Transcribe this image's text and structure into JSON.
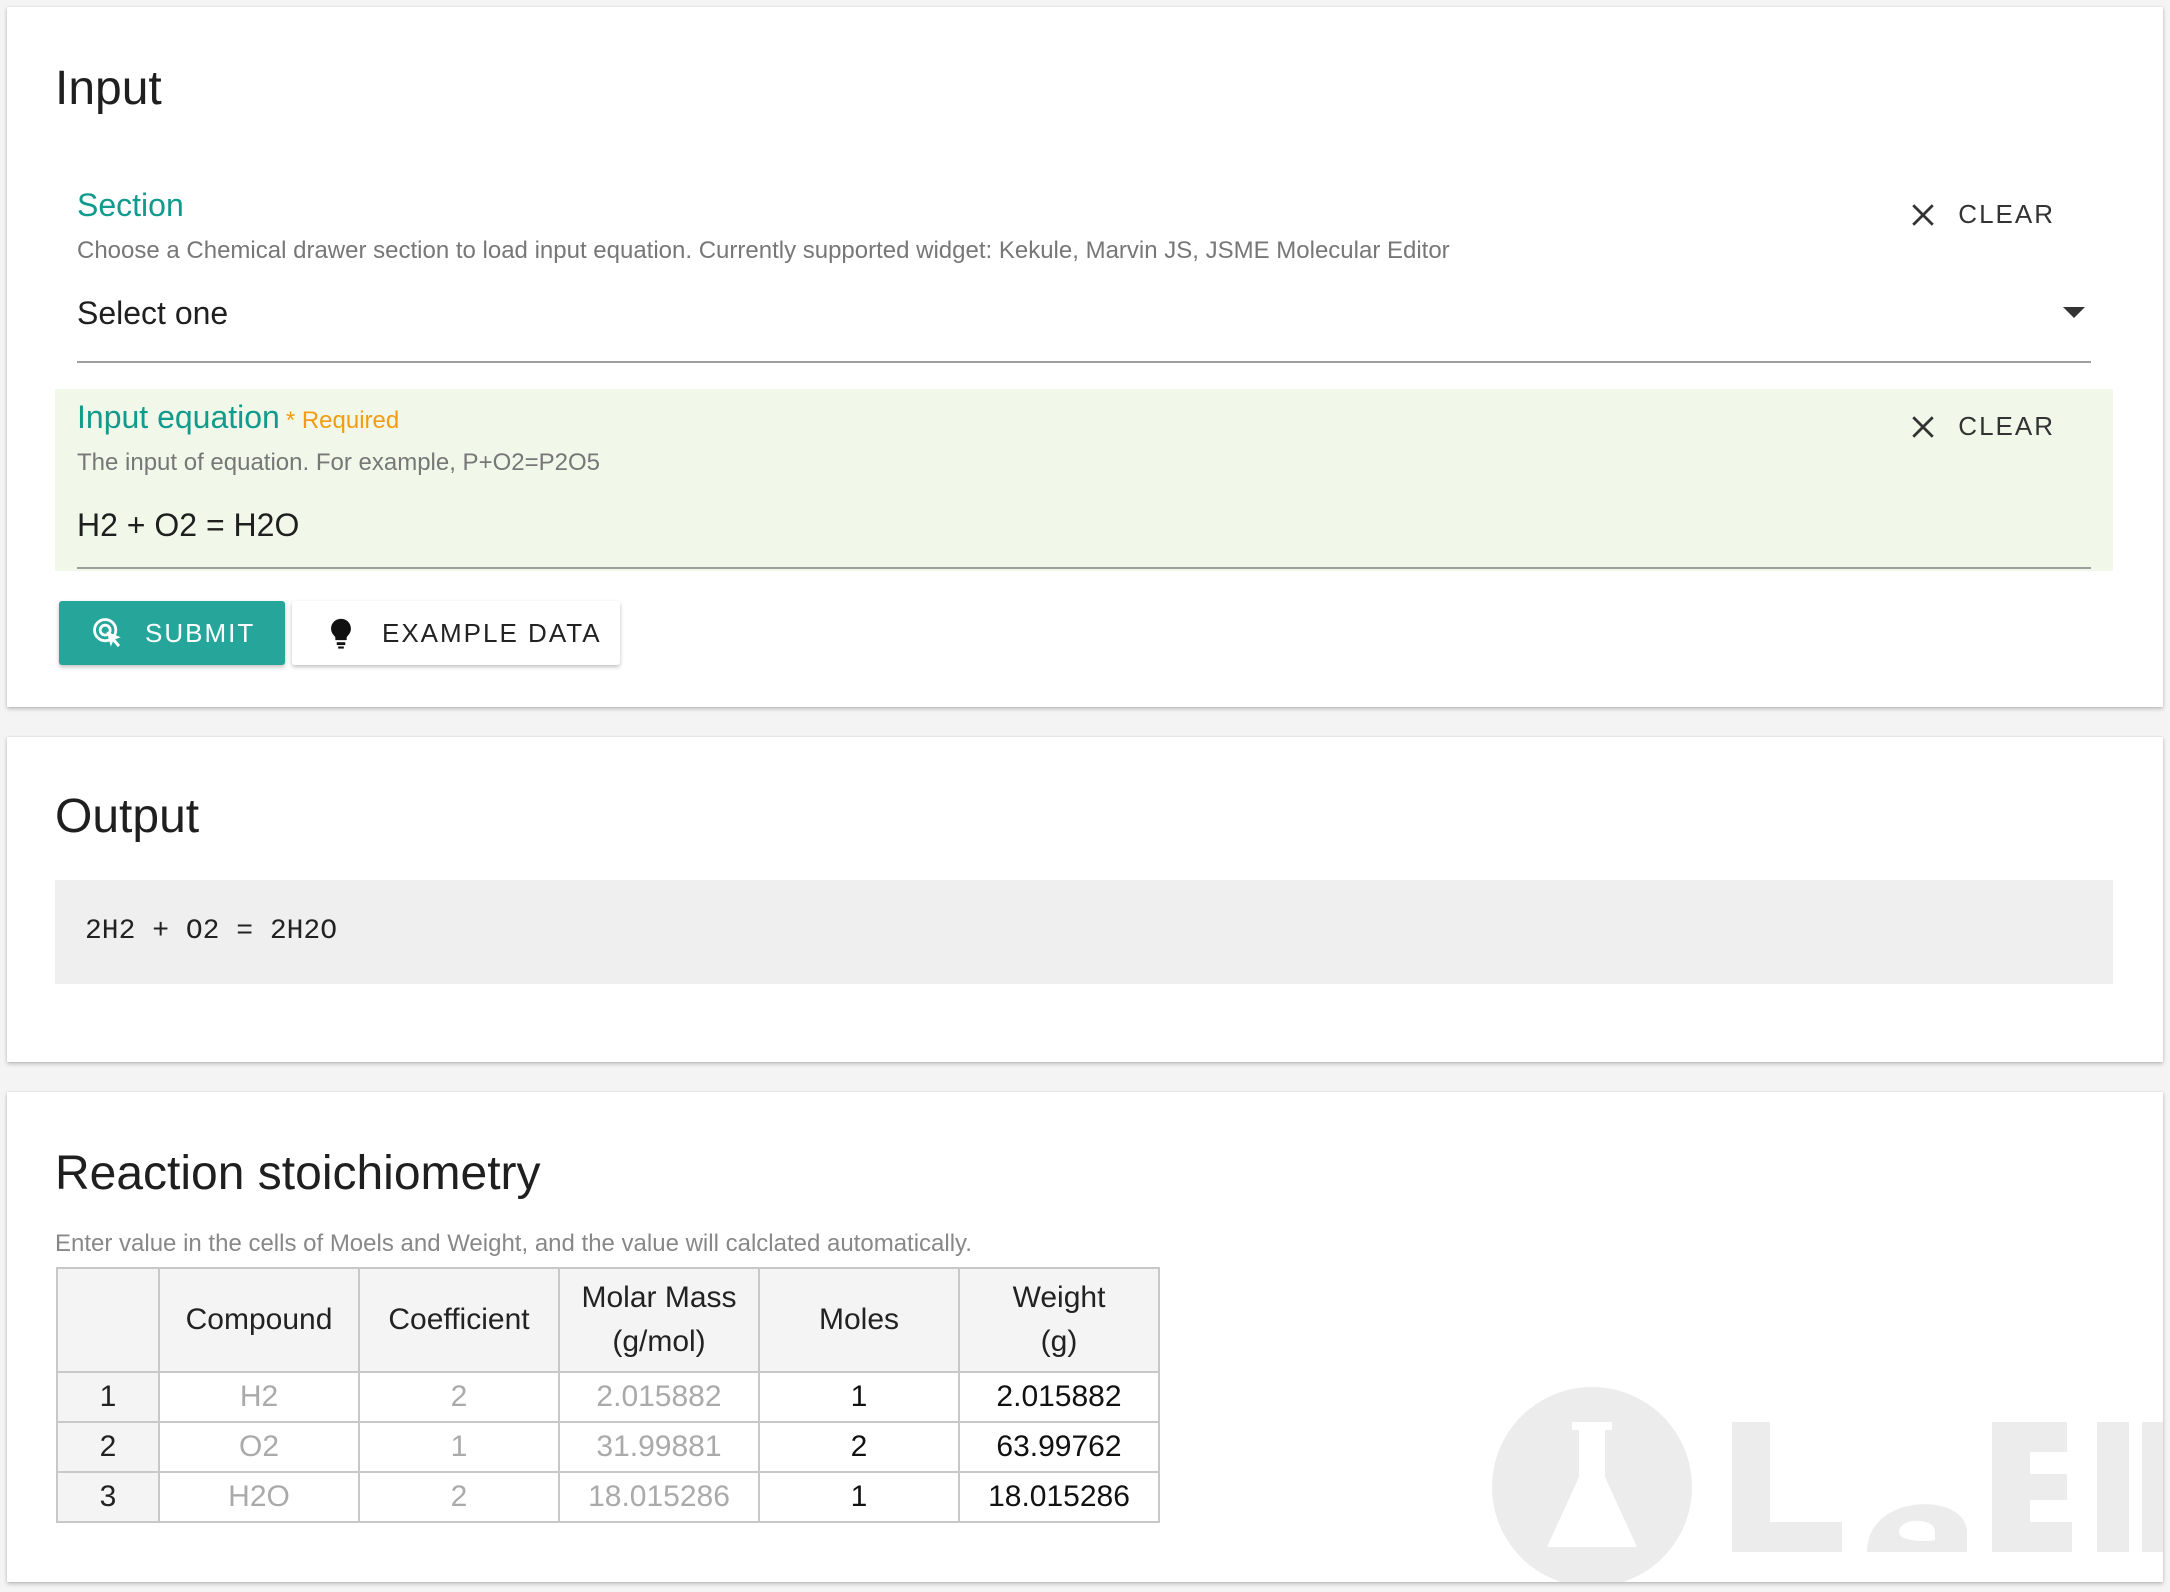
{
  "input_card": {
    "title": "Input",
    "section_field": {
      "label": "Section",
      "hint": "Choose a Chemical drawer section to load input equation. Currently supported widget: Kekule, Marvin JS, JSME Molecular Editor",
      "value": "Select one",
      "clear_label": "CLEAR"
    },
    "equation_field": {
      "label": "Input equation",
      "required_label": "* Required",
      "hint": "The input of equation. For example, P+O2=P2O5",
      "value": "H2 + O2 = H2O",
      "clear_label": "CLEAR"
    },
    "submit_label": "SUBMIT",
    "example_label": "EXAMPLE DATA"
  },
  "output_card": {
    "title": "Output",
    "result": "2H2 + O2 = 2H2O"
  },
  "stoich_card": {
    "title": "Reaction stoichiometry",
    "hint": "Enter value in the cells of Moels and Weight, and the value will calclated automatically.",
    "columns": [
      {
        "line1": "",
        "line2": ""
      },
      {
        "line1": "Compound",
        "line2": ""
      },
      {
        "line1": "Coefficient",
        "line2": ""
      },
      {
        "line1": "Molar Mass",
        "line2": "(g/mol)"
      },
      {
        "line1": "Moles",
        "line2": ""
      },
      {
        "line1": "Weight",
        "line2": "(g)"
      }
    ],
    "rows": [
      {
        "num": "1",
        "compound": "H2",
        "coefficient": "2",
        "molar_mass": "2.015882",
        "moles": "1",
        "weight": "2.015882"
      },
      {
        "num": "2",
        "compound": "O2",
        "coefficient": "1",
        "molar_mass": "31.99881",
        "moles": "2",
        "weight": "63.99762"
      },
      {
        "num": "3",
        "compound": "H2O",
        "coefficient": "2",
        "molar_mass": "18.015286",
        "moles": "1",
        "weight": "18.015286"
      }
    ]
  },
  "colors": {
    "accent": "#26a69a",
    "label_teal": "#129a8c",
    "required_orange": "#f39c12",
    "highlight_bg": "#f1f8e9"
  },
  "icons": {
    "clear": "close-icon",
    "submit": "touch-click-icon",
    "example": "lightbulb-icon",
    "dropdown": "caret-down-icon"
  }
}
